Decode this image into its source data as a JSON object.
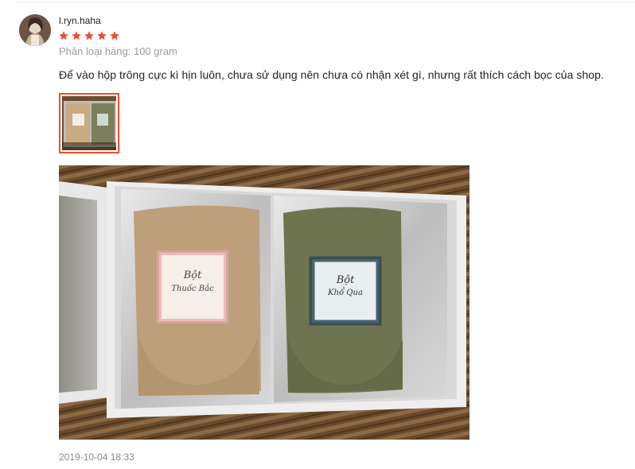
{
  "review": {
    "username": "l.ryn.haha",
    "rating": 5,
    "rating_max": 5,
    "star_color": "#ee4d2d",
    "variation": "Phân loại hàng: 100 gram",
    "comment": "Để vào hộp trông cực kì hịn luôn, chưa sử dụng nên chưa có nhận xét gì, nhưng rất thích cách bọc của shop.",
    "timestamp": "2019-10-04 18:33",
    "selected_thumb_border": "#ee4d2d",
    "photo": {
      "left_label_line1": "Bột",
      "left_label_line2": "Thuốc Bắc",
      "right_label_line1": "Bột",
      "right_label_line2": "Khổ Qua"
    }
  }
}
